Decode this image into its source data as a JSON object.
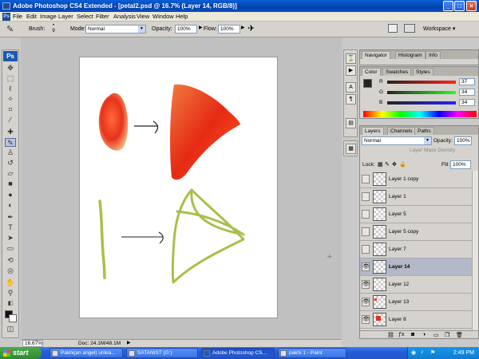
{
  "window": {
    "title": "Adobe Photoshop CS4 Extended - [petal2.psd @ 16.7% (Layer 14, RGB/8)]",
    "minimize": "_",
    "maximize": "□",
    "close": "×"
  },
  "app_badge": "Ps",
  "menu": [
    "File",
    "Edit",
    "Image",
    "Layer",
    "Select",
    "Filter",
    "Analysis",
    "View",
    "Window",
    "Help"
  ],
  "options": {
    "brush_label": "Brush:",
    "brush_size": "9",
    "mode_label": "Mode:",
    "mode_value": "Normal",
    "opacity_label": "Opacity:",
    "opacity_value": "100%",
    "flow_label": "Flow:",
    "flow_value": "100%",
    "workspace_label": "Workspace ▾"
  },
  "status": {
    "zoom": "16.67%",
    "doc": "Doc: 24.1M/48.1M"
  },
  "panels": {
    "top_tabs": [
      "Navigator",
      "Histogram",
      "Info"
    ],
    "color_tabs": [
      "Color",
      "Swatches",
      "Styles"
    ],
    "color": {
      "r_label": "R",
      "r_value": "37",
      "g_label": "G",
      "g_value": "34",
      "b_label": "B",
      "b_value": "34"
    },
    "layers_tabs": [
      "Layers",
      "Channels",
      "Paths"
    ],
    "blend_mode": "Normal",
    "opacity_label": "Opacity:",
    "opacity_value": "100%",
    "mask_density": "Layer Mask Density",
    "lock_label": "Lock:",
    "fill_label": "Fill:",
    "fill_value": "100%",
    "layers": [
      {
        "name": "Layer 1 copy",
        "visible": false,
        "selected": false
      },
      {
        "name": "Layer 1",
        "visible": false,
        "selected": false
      },
      {
        "name": "Layer 5",
        "visible": false,
        "selected": false
      },
      {
        "name": "Layer 5 copy",
        "visible": false,
        "selected": false
      },
      {
        "name": "Layer 7",
        "visible": false,
        "selected": false
      },
      {
        "name": "Layer 14",
        "visible": true,
        "selected": true
      },
      {
        "name": "Layer 12",
        "visible": true,
        "selected": false
      },
      {
        "name": "Layer 13",
        "visible": true,
        "selected": false
      },
      {
        "name": "Layer 8",
        "visible": true,
        "selected": false
      }
    ]
  },
  "taskbar": {
    "start": "start",
    "tasks": [
      "Pakhi(an angel) unlea...",
      "SATANIST (G:)",
      "Adobe Photoshop CS...",
      "pakhi 1 - Paint"
    ],
    "clock": "2:49 PM"
  },
  "colors": {
    "petal_red": "#e8321c",
    "stem_green": "#a8c04a"
  }
}
